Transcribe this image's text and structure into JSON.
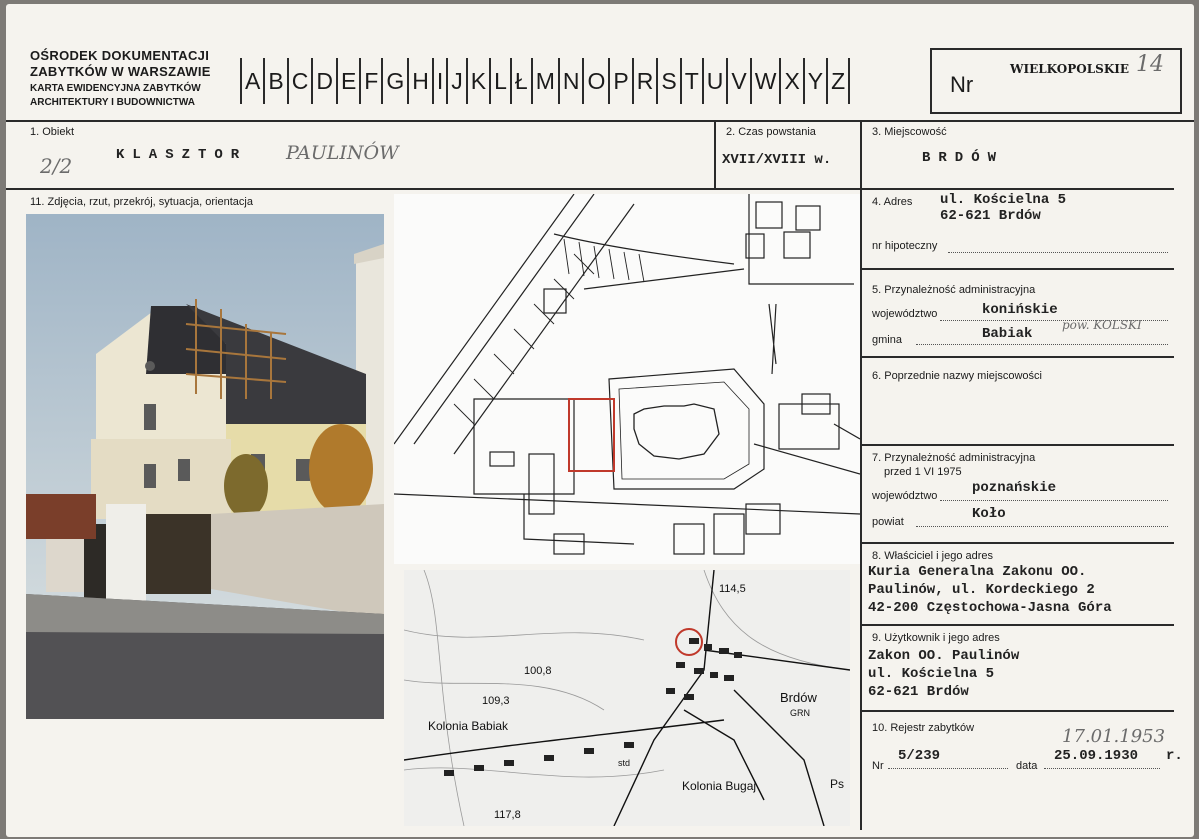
{
  "header": {
    "org_line1": "OŚRODEK DOKUMENTACJI",
    "org_line2": "ZABYTKÓW W WARSZAWIE",
    "org_line3": "KARTA EWIDENCYJNA ZABYTKÓW",
    "org_line4": "ARCHITEKTURY I BUDOWNICTWA",
    "letters": [
      "A",
      "B",
      "C",
      "D",
      "E",
      "F",
      "G",
      "H",
      "I",
      "J",
      "K",
      "L",
      "Ł",
      "M",
      "N",
      "O",
      "P",
      "R",
      "S",
      "T",
      "U",
      "V",
      "W",
      "X",
      "Y",
      "Z"
    ],
    "nr_label": "Nr",
    "region": "WIELKOPOLSKIE",
    "region_number": "14"
  },
  "fields": {
    "obiekt_label": "1. Obiekt",
    "obiekt_number": "2/2",
    "obiekt_typed": "KLASZTOR",
    "obiekt_hand": "PAULINÓW",
    "czas_label": "2. Czas powstania",
    "czas_value": "XVII/XVIII w.",
    "miejscowosc_label": "3. Miejscowość",
    "miejscowosc_value": "BRDÓW",
    "zdjecia_label": "11. Zdjęcia, rzut, przekrój, sytuacja, orientacja",
    "adres_label": "4. Adres",
    "adres_line1": "ul. Kościelna 5",
    "adres_line2": "62-621 Brdów",
    "hipoteczny_label": "nr hipoteczny",
    "przynaleznosc_label": "5. Przynależność administracyjna",
    "wojewodztwo_label": "województwo",
    "wojewodztwo_value": "konińskie",
    "gmina_label": "gmina",
    "gmina_value": "Babiak",
    "gmina_hand": "pow. KOLSKI",
    "poprzednie_label": "6. Poprzednie nazwy miejscowości",
    "przed_label1": "7. Przynależność administracyjna",
    "przed_label2": "przed 1 VI 1975",
    "przed_woj_label": "województwo",
    "przed_woj_value": "poznańskie",
    "powiat_label": "powiat",
    "powiat_value": "Koło",
    "wlasciciel_label": "8. Właściciel i jego adres",
    "wlasciciel_line1": "Kuria Generalna Zakonu OO.",
    "wlasciciel_line2": "Paulinów, ul. Kordeckiego 2",
    "wlasciciel_line3": "42-200 Częstochowa-Jasna Góra",
    "uzytkownik_label": "9. Użytkownik i jego adres",
    "uzytkownik_line1": "Zakon OO. Paulinów",
    "uzytkownik_line2": "ul. Kościelna 5",
    "uzytkownik_line3": "62-621 Brdów",
    "rejestr_label": "10. Rejestr zabytków",
    "rejestr_nr_label": "Nr",
    "rejestr_nr": "5/239",
    "rejestr_data_label": "data",
    "rejestr_data_hand": "17.01.1953",
    "rejestr_data": "25.09.1930",
    "rejestr_r": "r."
  },
  "topo_map": {
    "label_kolonia_babiak": "Kolonia Babiak",
    "label_brdow": "Brdów",
    "label_grn": "GRN",
    "label_kolonia_bugaj": "Kolonia Bugaj",
    "label_ps": "Ps",
    "label_std": "std",
    "elev_1": "114,5",
    "elev_2": "100,8",
    "elev_3": "109,3",
    "elev_4": "117,8"
  }
}
